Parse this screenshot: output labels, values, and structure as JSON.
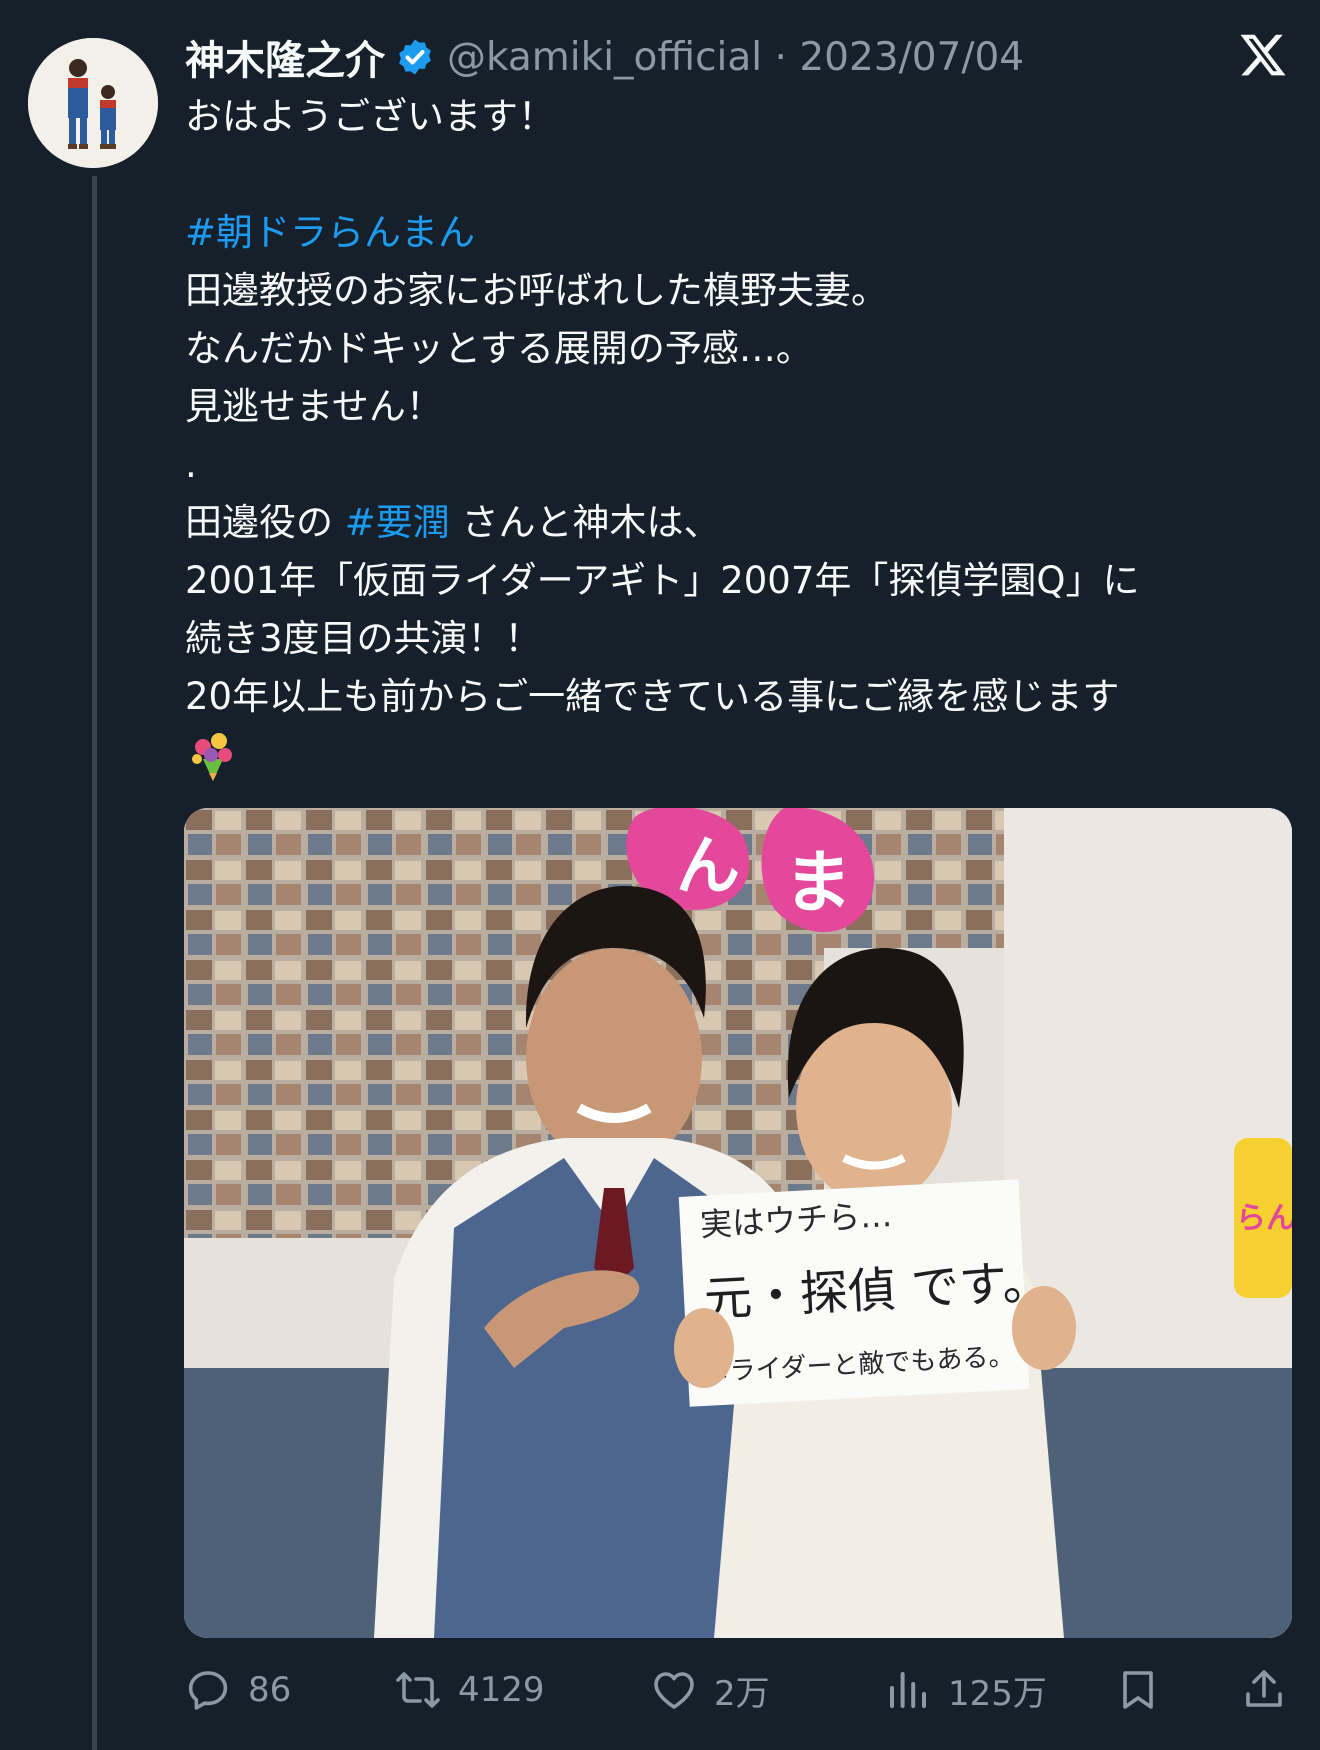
{
  "tweet": {
    "display_name": "神木隆之介",
    "handle_and_date": "@kamiki_official · 2023/07/04",
    "lines": {
      "l1": "おはようございます！",
      "hashtag1": "#朝ドラらんまん",
      "l3": "田邊教授のお家にお呼ばれした槙野夫妻。",
      "l4": "なんだかドキッとする展開の予感…。",
      "l5": "見逃せません！",
      "l6": ".",
      "l7_before": "田邊役の ",
      "hashtag2": "#要潤",
      "l7_after": " さんと神木は、",
      "l8": "2001年「仮面ライダーアギト」2007年「探偵学園Q」に",
      "l9": "続き3度目の共演！！",
      "l10": "20年以上も前からご一緒できている事にご縁を感じます"
    },
    "photo": {
      "sign_line1": "実はウチら…",
      "sign_line2": "元・探偵 です。",
      "sign_line3": "※ライダーと敵でもある。",
      "backdrop_glyph1": "ん",
      "backdrop_glyph2": "ま",
      "backdrop_sticker": "らん"
    }
  },
  "actions": {
    "replies": "86",
    "retweets": "4129",
    "likes": "2万",
    "views": "125万"
  },
  "colors": {
    "background": "#15202b",
    "text": "#f7f9f9",
    "secondary": "#8b98a5",
    "link": "#1d9bf0"
  },
  "icons": [
    "verified-badge-icon",
    "x-logo-icon",
    "reply-icon",
    "retweet-icon",
    "like-icon",
    "views-icon",
    "bookmark-icon",
    "share-icon",
    "bouquet-emoji-icon"
  ]
}
